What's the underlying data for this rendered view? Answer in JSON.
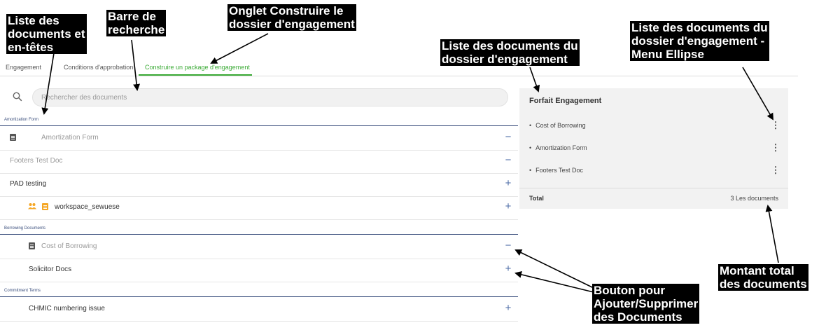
{
  "tabs": [
    {
      "label": "Engagement"
    },
    {
      "label": "Conditions d'approbation"
    },
    {
      "label": "Construire un package d'engagement",
      "active": true
    }
  ],
  "search": {
    "placeholder": "Rechercher des documents",
    "icon": "search-icon"
  },
  "sections": [
    {
      "header": "Amortization Form",
      "rows": [
        {
          "label": "Amortization Form",
          "state": "added",
          "action": "−",
          "icon": "doc-icon"
        },
        {
          "label": "Footers Test Doc",
          "state": "added",
          "action": "−"
        },
        {
          "label": "PAD testing",
          "state": "available",
          "action": "+"
        },
        {
          "label": "workspace_sewuese",
          "state": "available",
          "action": "+",
          "icon": "doc-icon",
          "people": true
        }
      ]
    },
    {
      "header": "Borrowing Documents",
      "rows": [
        {
          "label": "Cost of Borrowing",
          "state": "added",
          "action": "−",
          "icon": "doc-icon"
        },
        {
          "label": "Solicitor Docs",
          "state": "available",
          "action": "+"
        }
      ]
    },
    {
      "header": "Commitment Terms",
      "rows": [
        {
          "label": "CHMIC numbering issue",
          "state": "available",
          "action": "+"
        }
      ]
    }
  ],
  "package": {
    "title": "Forfait Engagement",
    "items": [
      "Cost of Borrowing",
      "Amortization Form",
      "Footers Test Doc"
    ],
    "ellipsis": "⋮",
    "total_label": "Total",
    "total_value": "3 Les documents"
  },
  "annotations": {
    "doc_list": "Liste des\ndocuments et\nen-têtes",
    "search_bar": "Barre de\nrecherche",
    "build_tab": "Onglet Construire le\ndossier d'engagement",
    "pkg_list": "Liste des documents du\ndossier d'engagement",
    "pkg_menu": "Liste des documents du\ndossier d'engagement -\nMenu Ellipse",
    "total": "Montant total\ndes documents",
    "add_remove": "Bouton pour\nAjouter/Supprimer\ndes Documents"
  },
  "colors": {
    "accent_green": "#3aaa35",
    "section_blue": "#3b4f7d",
    "action_blue": "#4a6aa5",
    "doc_icon_added": "#555555",
    "doc_icon_available": "#f5a623"
  }
}
